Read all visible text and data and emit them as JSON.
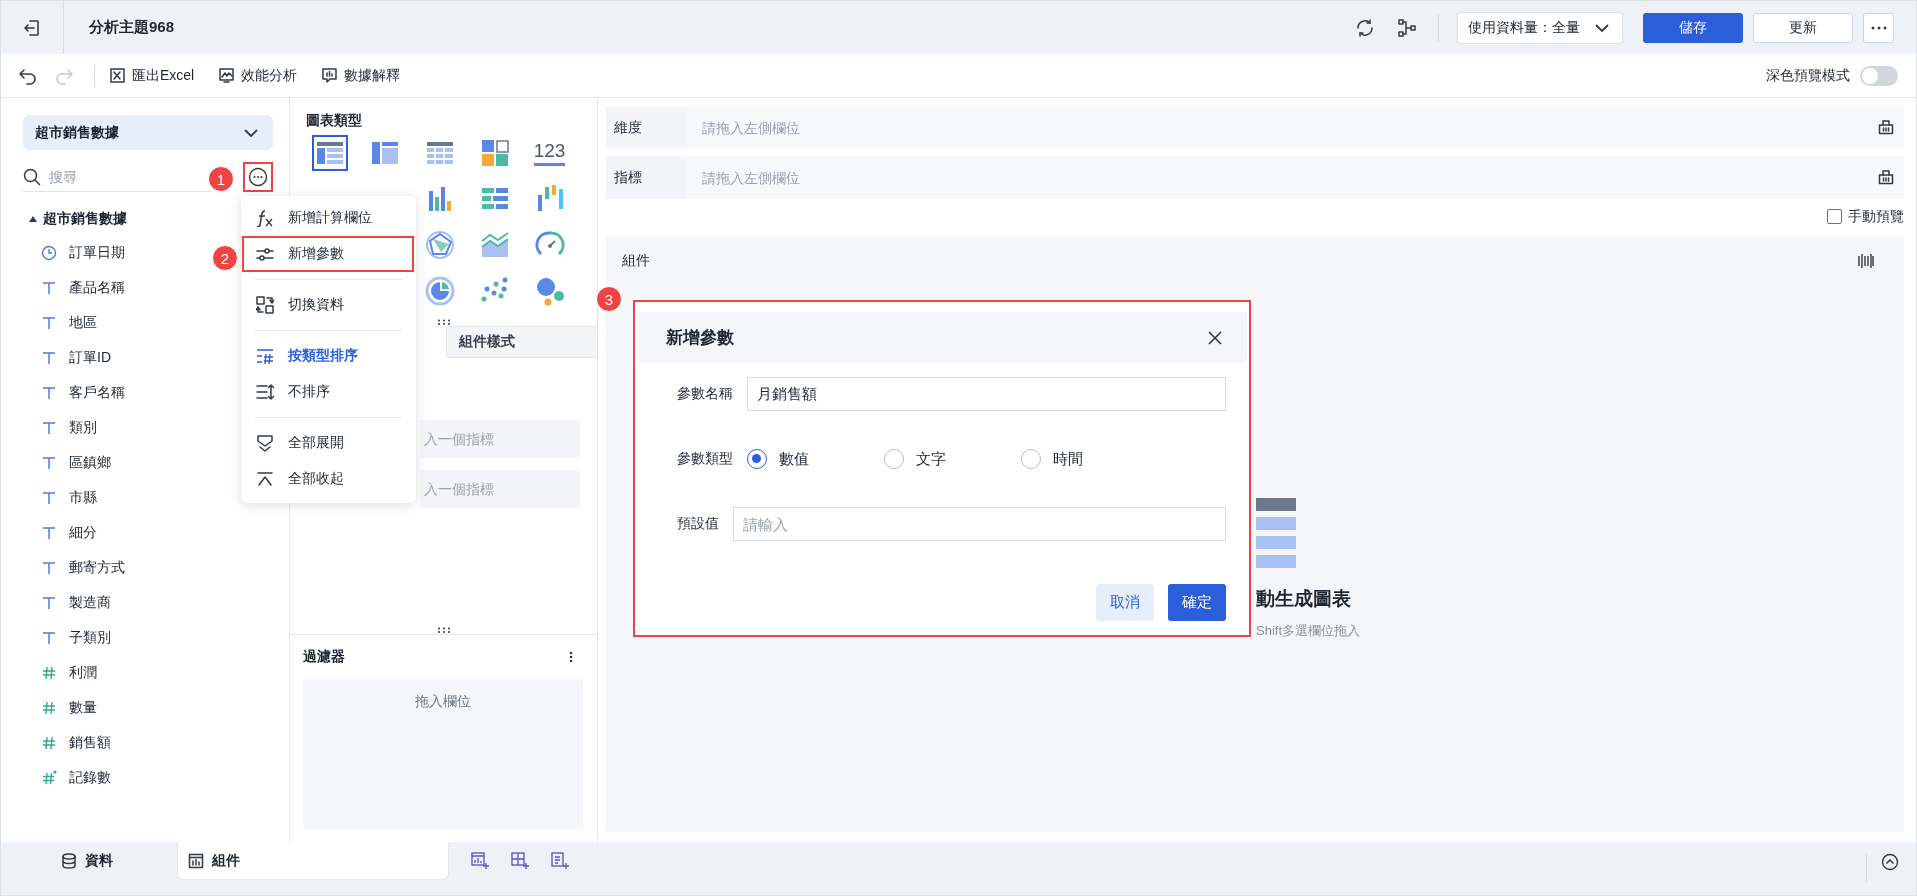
{
  "topbar": {
    "title": "分析主題968",
    "data_volume": "使用資料量：全量",
    "buttons": [
      {
        "label": "儲存",
        "kind": "primary"
      },
      {
        "label": "更新",
        "kind": "default"
      }
    ]
  },
  "toolbar": {
    "history": [
      {
        "kind": "undo",
        "disabled": false
      },
      {
        "kind": "redo",
        "disabled": true
      }
    ],
    "actions": [
      {
        "kind": "excel",
        "label": "匯出Excel"
      },
      {
        "kind": "performance",
        "label": "效能分析"
      },
      {
        "kind": "explain",
        "label": "數據解釋"
      }
    ],
    "dark_preview": {
      "label": "深色預覽模式",
      "on": false
    }
  },
  "data_panel": {
    "dataset": "超市銷售數據",
    "search": {
      "placeholder": "搜尋"
    },
    "more_highlighted": true,
    "tree": [
      {
        "label": "超市銷售數據",
        "expanded": true,
        "children": [
          {
            "label": "訂單日期",
            "kind": "date"
          },
          {
            "label": "產品名稱",
            "kind": "text"
          },
          {
            "label": "地區",
            "kind": "text"
          },
          {
            "label": "訂單ID",
            "kind": "text"
          },
          {
            "label": "客戶名稱",
            "kind": "text"
          },
          {
            "label": "類別",
            "kind": "text"
          },
          {
            "label": "區鎮鄉",
            "kind": "text"
          },
          {
            "label": "市縣",
            "kind": "text"
          },
          {
            "label": "細分",
            "kind": "text"
          },
          {
            "label": "郵寄方式",
            "kind": "text"
          },
          {
            "label": "製造商",
            "kind": "text"
          },
          {
            "label": "子類別",
            "kind": "text"
          },
          {
            "label": "利潤",
            "kind": "number"
          },
          {
            "label": "數量",
            "kind": "number"
          },
          {
            "label": "銷售額",
            "kind": "number"
          },
          {
            "label": "記錄數",
            "kind": "count"
          }
        ]
      }
    ]
  },
  "menu": {
    "groups": [
      [
        {
          "kind": "function",
          "label": "新增計算欄位",
          "selected": false,
          "highlighted": false
        },
        {
          "kind": "parameter",
          "label": "新增參數",
          "selected": false,
          "highlighted": true
        }
      ],
      [
        {
          "kind": "switch",
          "label": "切換資料",
          "selected": false,
          "highlighted": false
        }
      ],
      [
        {
          "kind": "sort-type",
          "label": "按類型排序",
          "selected": true,
          "highlighted": false
        },
        {
          "kind": "no-sort",
          "label": "不排序",
          "selected": false,
          "highlighted": false
        }
      ],
      [
        {
          "kind": "expand",
          "label": "全部展開",
          "selected": false,
          "highlighted": false
        },
        {
          "kind": "collapse",
          "label": "全部收起",
          "selected": false,
          "highlighted": false
        }
      ]
    ]
  },
  "chart_panel": {
    "title": "圖表類型",
    "chart_rows": [
      [
        {
          "kind": "detail-table",
          "selected": true
        },
        {
          "kind": "crosstab",
          "selected": false
        },
        {
          "kind": "grouped-table",
          "selected": false
        },
        {
          "kind": "kpi",
          "selected": false
        },
        {
          "kind": "number",
          "glyph": "123",
          "selected": false
        }
      ],
      [
        {
          "kind": "bar",
          "selected": false
        },
        {
          "kind": "hbar",
          "selected": false
        },
        {
          "kind": "waterfall",
          "selected": false
        }
      ],
      [
        {
          "kind": "radar",
          "selected": false
        },
        {
          "kind": "area",
          "selected": false
        },
        {
          "kind": "gauge",
          "selected": false
        }
      ],
      [
        {
          "kind": "ring",
          "selected": false
        },
        {
          "kind": "scatter",
          "selected": false
        },
        {
          "kind": "bubble",
          "selected": false
        }
      ]
    ],
    "tabs": [
      {
        "label": "組件樣式",
        "selected": false
      }
    ],
    "metric_fields": [
      {
        "placeholder": "入一個指標"
      },
      {
        "placeholder": "入一個指標"
      }
    ],
    "filter": {
      "title": "過濾器",
      "drop_hint": "拖入欄位"
    }
  },
  "shelves": [
    {
      "label": "維度",
      "placeholder": "請拖入左側欄位"
    },
    {
      "label": "指標",
      "placeholder": "請拖入左側欄位"
    }
  ],
  "manual_preview": {
    "label": "手動預覽",
    "checked": false
  },
  "canvas": {
    "title": "組件",
    "hint_title": "動生成圖表",
    "hint": "Shift多選欄位拖入"
  },
  "dialog": {
    "title": "新增參數",
    "highlighted": true,
    "fields": [
      {
        "kind": "text",
        "label": "參數名稱",
        "value": "月銷售額"
      },
      {
        "kind": "radio",
        "label": "參數類型",
        "options": [
          {
            "label": "數值",
            "selected": true
          },
          {
            "label": "文字",
            "selected": false
          },
          {
            "label": "時間",
            "selected": false
          }
        ]
      },
      {
        "kind": "text",
        "label": "預設值",
        "placeholder": "請輸入"
      }
    ],
    "buttons": [
      {
        "label": "取消",
        "kind": "secondary"
      },
      {
        "label": "確定",
        "kind": "primary"
      }
    ]
  },
  "bottom_tabs": [
    {
      "kind": "data",
      "label": "資料",
      "selected": false
    },
    {
      "kind": "component",
      "label": "組件",
      "selected": true
    }
  ],
  "annotations": [
    {
      "label": "1"
    },
    {
      "label": "2"
    },
    {
      "label": "3"
    }
  ]
}
